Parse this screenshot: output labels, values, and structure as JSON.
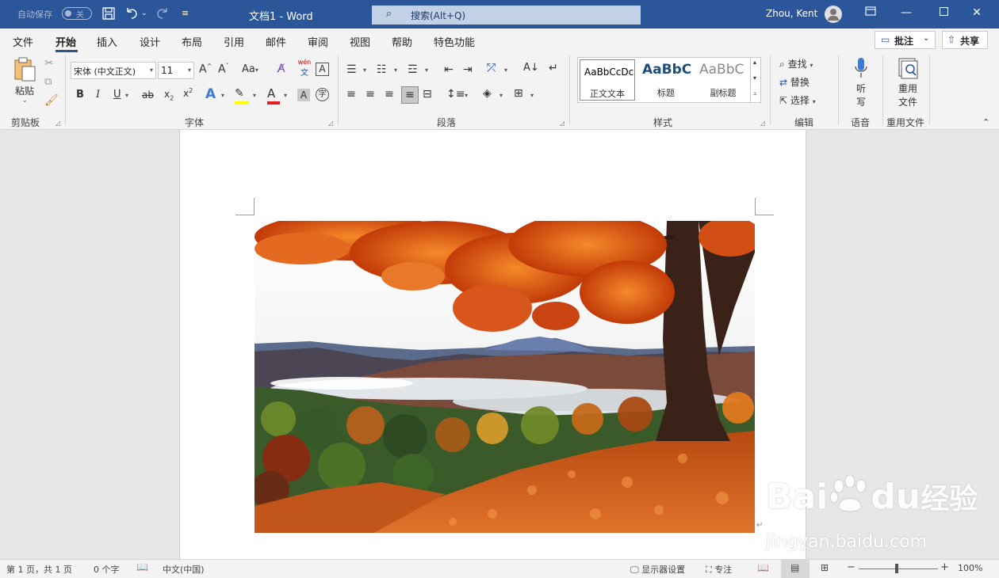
{
  "titlebar": {
    "autosave_label": "自动保存",
    "autosave_state": "关",
    "doc_title": "文档1  -  Word",
    "search_placeholder": "搜索(Alt+Q)",
    "user_name": "Zhou, Kent"
  },
  "menu": {
    "tabs": [
      "文件",
      "开始",
      "插入",
      "设计",
      "布局",
      "引用",
      "邮件",
      "审阅",
      "视图",
      "帮助",
      "特色功能"
    ],
    "active_tab": "开始",
    "comment_label": "批注",
    "share_label": "共享"
  },
  "ribbon": {
    "clipboard": {
      "paste_label": "粘贴",
      "group_label": "剪贴板"
    },
    "font": {
      "font_name": "宋体 (中文正文)",
      "font_size": "11",
      "group_label": "字体",
      "aa_label": "Aa",
      "phonetic_top": "wén",
      "phonetic_bottom": "文"
    },
    "paragraph": {
      "group_label": "段落"
    },
    "styles": {
      "group_label": "样式",
      "items": [
        {
          "sample": "AaBbCcDc",
          "name": "正文文本"
        },
        {
          "sample": "AaBbC",
          "name": "标题"
        },
        {
          "sample": "AaBbC",
          "name": "副标题"
        }
      ]
    },
    "editing": {
      "find": "查找",
      "replace": "替换",
      "select": "选择",
      "group_label": "编辑"
    },
    "voice": {
      "dictate_line1": "听",
      "dictate_line2": "写",
      "group_label": "语音"
    },
    "reuse": {
      "line1": "重用",
      "line2": "文件",
      "group_label": "重用文件"
    }
  },
  "statusbar": {
    "page_info": "第 1 页，共 1 页",
    "word_count": "0 个字",
    "language": "中文(中国)",
    "display_settings": "显示器设置",
    "focus": "专注",
    "zoom": "100%",
    "zoom_level": 1.0
  },
  "watermark": {
    "brand": "Bai",
    "brand2": "du",
    "cn": "经验",
    "url": "jingyan.baidu.com"
  },
  "colors": {
    "titlebar": "#2b579a",
    "accent": "#2b579a",
    "ribbon_bg": "#f3f3f3",
    "canvas_bg": "#e6e6e6"
  }
}
